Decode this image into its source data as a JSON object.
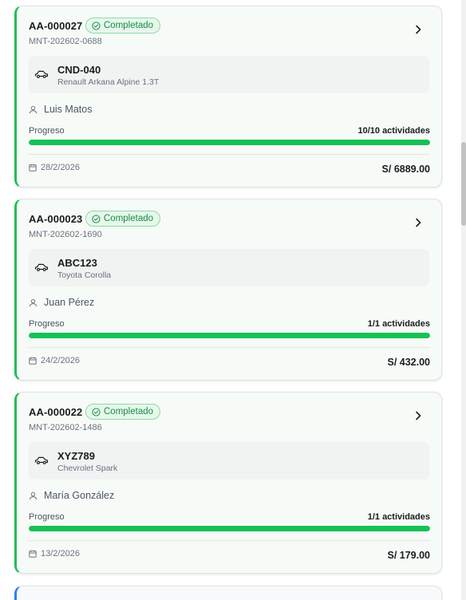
{
  "orders": [
    {
      "code": "AA-000027",
      "status": "Completado",
      "ref": "MNT-202602-0688",
      "plate": "CND-040",
      "model": "Renault Arkana Alpine 1.3T",
      "client": "Luis Matos",
      "progress_label": "Progreso",
      "progress_text": "10/10 actividades",
      "progress_fraction": 1.0,
      "date": "28/2/2026",
      "amount": "S/ 6889.00"
    },
    {
      "code": "AA-000023",
      "status": "Completado",
      "ref": "MNT-202602-1690",
      "plate": "ABC123",
      "model": "Toyota Corolla",
      "client": "Juan Pérez",
      "progress_label": "Progreso",
      "progress_text": "1/1 actividades",
      "progress_fraction": 1.0,
      "date": "24/2/2026",
      "amount": "S/ 432.00"
    },
    {
      "code": "AA-000022",
      "status": "Completado",
      "ref": "MNT-202602-1486",
      "plate": "XYZ789",
      "model": "Chevrolet Spark",
      "client": "María González",
      "progress_label": "Progreso",
      "progress_text": "1/1 actividades",
      "progress_fraction": 1.0,
      "date": "13/2/2026",
      "amount": "S/ 179.00"
    }
  ],
  "colors": {
    "completed_accent": "#1fbf57",
    "badge_text": "#1b8d47",
    "badge_bg": "#e6f7ec",
    "progress_fill": "#16c155",
    "next_card_accent": "#2f80ed"
  },
  "icons": {
    "status": "check-circle-icon",
    "open": "chevron-right-icon",
    "vehicle": "car-icon",
    "client": "user-icon",
    "date": "calendar-icon"
  }
}
